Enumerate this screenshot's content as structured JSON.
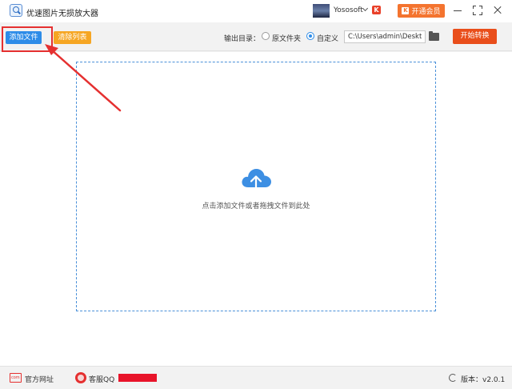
{
  "window": {
    "title": "优速图片无损放大器",
    "user_name": "Yososoft",
    "vip_label": "开通会员",
    "vip_icon_glyph": "K",
    "badge_glyph": "K"
  },
  "toolbar": {
    "add_file_label": "添加文件",
    "clear_list_label": "清除列表",
    "output_dir_label": "输出目录：",
    "option_original_label": "原文件夹",
    "option_custom_label": "自定义",
    "selected_option": "custom",
    "path_value": "C:\\Users\\admin\\Deskto",
    "start_label": "开始转换"
  },
  "main": {
    "drop_hint": "点击添加文件或者拖拽文件到此处"
  },
  "statusbar": {
    "website_label": "官方网址",
    "service_label": "客服QQ",
    "version_label": "版本：v2.0.1"
  },
  "colors": {
    "primary_blue": "#2d8ce8",
    "clear_orange": "#f6a623",
    "start_red": "#e94e1b",
    "vip_orange": "#f4742f",
    "highlight_red": "#e53030"
  },
  "icons": {
    "app": "magnifier-image-icon",
    "folder": "folder-icon",
    "upload": "cloud-upload-icon",
    "website": "website-icon",
    "service": "customer-service-icon",
    "refresh": "refresh-icon"
  }
}
